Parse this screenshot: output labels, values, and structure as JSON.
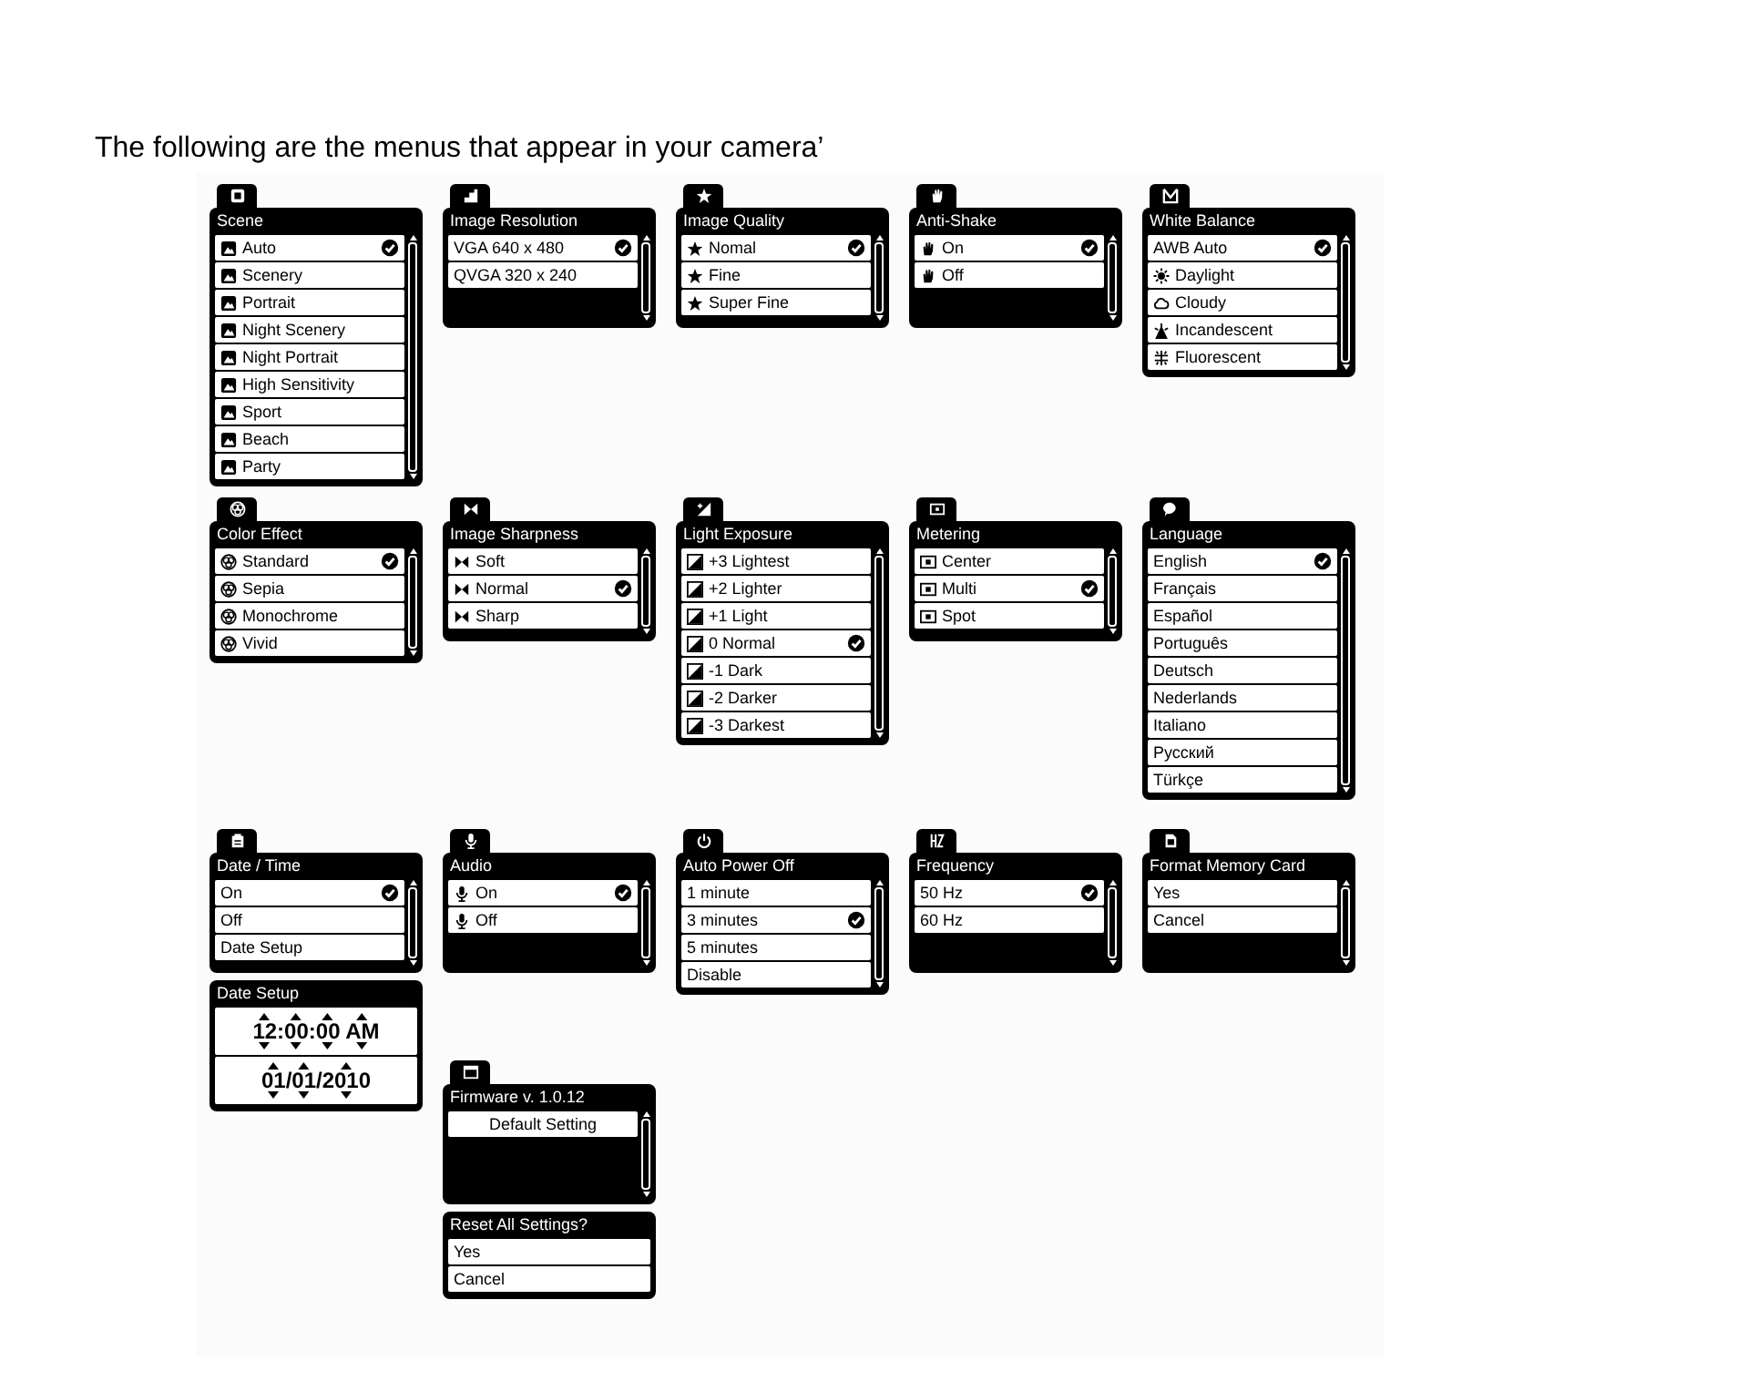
{
  "intro": "The following are the menus that appear in your camera’",
  "menu_rows": [
    [
      [
        {
          "kind": "scene",
          "tab": true,
          "title": "Scene",
          "scrollbar": true,
          "items": [
            {
              "kind": "scene",
              "label": "Auto",
              "selected": true
            },
            {
              "kind": "scene",
              "label": "Scenery",
              "selected": false
            },
            {
              "kind": "scene",
              "label": "Portrait",
              "selected": false
            },
            {
              "kind": "scene",
              "label": "Night Scenery",
              "selected": false
            },
            {
              "kind": "scene",
              "label": "Night Portrait",
              "selected": false
            },
            {
              "kind": "scene",
              "label": "High Sensitivity",
              "selected": false
            },
            {
              "kind": "scene",
              "label": "Sport",
              "selected": false
            },
            {
              "kind": "scene",
              "label": "Beach",
              "selected": false
            },
            {
              "kind": "scene",
              "label": "Party",
              "selected": false
            }
          ]
        }
      ],
      [
        {
          "kind": "resolution",
          "tab": true,
          "title": "Image Resolution",
          "scrollbar": true,
          "items": [
            {
              "kind": "plain",
              "label": "VGA 640 x 480",
              "selected": true
            },
            {
              "kind": "plain",
              "label": "QVGA 320 x 240",
              "selected": false
            }
          ]
        }
      ],
      [
        {
          "kind": "quality",
          "tab": true,
          "title": "Image Quality",
          "scrollbar": true,
          "items": [
            {
              "kind": "star",
              "label": "Nomal",
              "selected": true
            },
            {
              "kind": "star",
              "label": "Fine",
              "selected": false
            },
            {
              "kind": "star",
              "label": "Super Fine",
              "selected": false
            }
          ]
        }
      ],
      [
        {
          "kind": "shake",
          "tab": true,
          "title": "Anti-Shake",
          "scrollbar": true,
          "items": [
            {
              "kind": "hand",
              "label": "On",
              "selected": true
            },
            {
              "kind": "hand",
              "label": "Off",
              "selected": false
            }
          ]
        }
      ],
      [
        {
          "kind": "balance",
          "tab": true,
          "title": "White Balance",
          "scrollbar": true,
          "items": [
            {
              "kind": "plain",
              "label": "AWB Auto",
              "selected": true
            },
            {
              "kind": "sun",
              "label": "Daylight",
              "selected": false
            },
            {
              "kind": "cloud",
              "label": "Cloudy",
              "selected": false
            },
            {
              "kind": "lamp",
              "label": "Incandescent",
              "selected": false
            },
            {
              "kind": "tube",
              "label": "Fluorescent",
              "selected": false
            }
          ]
        }
      ]
    ],
    [
      [
        {
          "kind": "color",
          "tab": true,
          "title": "Color Effect",
          "scrollbar": true,
          "items": [
            {
              "kind": "palette",
              "label": "Standard",
              "selected": true
            },
            {
              "kind": "palette",
              "label": "Sepia",
              "selected": false
            },
            {
              "kind": "palette",
              "label": "Monochrome",
              "selected": false
            },
            {
              "kind": "palette",
              "label": "Vivid",
              "selected": false
            }
          ]
        }
      ],
      [
        {
          "kind": "sharpness",
          "tab": true,
          "title": "Image Sharpness",
          "scrollbar": true,
          "items": [
            {
              "kind": "bowtie",
              "label": "Soft",
              "selected": false
            },
            {
              "kind": "bowtie",
              "label": "Normal",
              "selected": true
            },
            {
              "kind": "bowtie",
              "label": "Sharp",
              "selected": false
            }
          ]
        }
      ],
      [
        {
          "kind": "exposure",
          "tab": true,
          "title": "Light Exposure",
          "scrollbar": true,
          "items": [
            {
              "kind": "exposure",
              "label": "+3 Lightest",
              "selected": false
            },
            {
              "kind": "exposure",
              "label": "+2 Lighter",
              "selected": false
            },
            {
              "kind": "exposure",
              "label": "+1 Light",
              "selected": false
            },
            {
              "kind": "exposure",
              "label": "0 Normal",
              "selected": true
            },
            {
              "kind": "exposure",
              "label": "-1 Dark",
              "selected": false
            },
            {
              "kind": "exposure",
              "label": "-2 Darker",
              "selected": false
            },
            {
              "kind": "exposure",
              "label": "-3 Darkest",
              "selected": false
            }
          ]
        }
      ],
      [
        {
          "kind": "metering",
          "tab": true,
          "title": "Metering",
          "scrollbar": true,
          "items": [
            {
              "kind": "meter",
              "label": "Center",
              "selected": false
            },
            {
              "kind": "meter",
              "label": "Multi",
              "selected": true
            },
            {
              "kind": "meter",
              "label": "Spot",
              "selected": false
            }
          ]
        }
      ],
      [
        {
          "kind": "language",
          "tab": true,
          "title": "Language",
          "scrollbar": true,
          "items": [
            {
              "kind": "plain",
              "label": "English",
              "selected": true
            },
            {
              "kind": "plain",
              "label": "Français",
              "selected": false
            },
            {
              "kind": "plain",
              "label": "Español",
              "selected": false
            },
            {
              "kind": "plain",
              "label": "Português",
              "selected": false
            },
            {
              "kind": "plain",
              "label": "Deutsch",
              "selected": false
            },
            {
              "kind": "plain",
              "label": "Nederlands",
              "selected": false
            },
            {
              "kind": "plain",
              "label": "Italiano",
              "selected": false
            },
            {
              "kind": "plain",
              "label": "Русский",
              "selected": false
            },
            {
              "kind": "plain",
              "label": "Türkçe",
              "selected": false
            }
          ]
        }
      ]
    ],
    [
      [
        {
          "kind": "datetime",
          "tab": true,
          "title": "Date / Time",
          "scrollbar": true,
          "items": [
            {
              "kind": "plain",
              "label": "On",
              "selected": true
            },
            {
              "kind": "plain",
              "label": "Off",
              "selected": false
            },
            {
              "kind": "plain",
              "label": "Date Setup",
              "selected": false
            }
          ]
        },
        {
          "tab": false,
          "title": "Date Setup",
          "scrollbar": false,
          "items": [
            {
              "kind": "spinner",
              "label": "12:00:00 AM"
            },
            {
              "kind": "spinner",
              "label": "01/01/2010"
            }
          ]
        }
      ],
      [
        {
          "kind": "audio",
          "tab": true,
          "title": "Audio",
          "scrollbar": true,
          "items": [
            {
              "kind": "mic",
              "label": "On",
              "selected": true
            },
            {
              "kind": "mic",
              "label": "Off",
              "selected": false
            }
          ]
        },
        {
          "kind": "firmware",
          "tab": true,
          "title": "Firmware v. 1.0.12",
          "scrollbar": true,
          "items": [
            {
              "kind": "centered",
              "label": "Default Setting",
              "selected": false
            }
          ]
        },
        {
          "tab": false,
          "title": "Reset All Settings?",
          "scrollbar": false,
          "items": [
            {
              "kind": "plain",
              "label": "Yes",
              "selected": false
            },
            {
              "kind": "plain",
              "label": "Cancel",
              "selected": false
            }
          ]
        }
      ],
      [
        {
          "kind": "power",
          "tab": true,
          "title": "Auto Power Off",
          "scrollbar": true,
          "items": [
            {
              "kind": "plain",
              "label": "1 minute",
              "selected": false
            },
            {
              "kind": "plain",
              "label": "3 minutes",
              "selected": true
            },
            {
              "kind": "plain",
              "label": "5 minutes",
              "selected": false
            },
            {
              "kind": "plain",
              "label": "Disable",
              "selected": false
            }
          ]
        }
      ],
      [
        {
          "kind": "frequency",
          "tab": true,
          "title": "Frequency",
          "scrollbar": true,
          "items": [
            {
              "kind": "plain",
              "label": "50 Hz",
              "selected": true
            },
            {
              "kind": "plain",
              "label": "60 Hz",
              "selected": false
            }
          ]
        }
      ],
      [
        {
          "kind": "format",
          "tab": true,
          "title": "Format Memory Card",
          "scrollbar": true,
          "items": [
            {
              "kind": "plain",
              "label": "Yes",
              "selected": false
            },
            {
              "kind": "plain",
              "label": "Cancel",
              "selected": false
            }
          ]
        }
      ]
    ]
  ]
}
